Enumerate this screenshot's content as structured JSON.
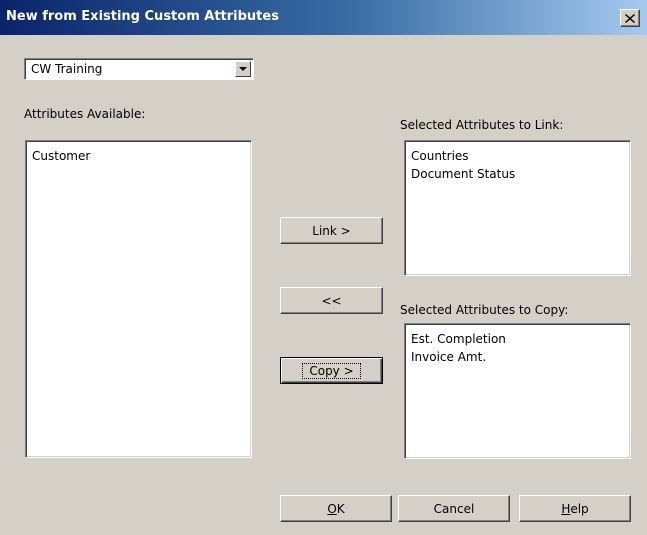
{
  "window": {
    "title": "New from Existing Custom Attributes",
    "close_glyph": "✕"
  },
  "project_select": {
    "value": "CW Training",
    "arrow_icon": "chevron-down-icon"
  },
  "available": {
    "label": "Attributes Available:",
    "items": [
      "Customer"
    ]
  },
  "link_list": {
    "label": "Selected Attributes to Link:",
    "items": [
      "Countries",
      "Document Status"
    ]
  },
  "copy_list": {
    "label": "Selected Attributes to Copy:",
    "items": [
      "Est. Completion",
      "Invoice Amt."
    ]
  },
  "buttons": {
    "link": "Link >",
    "remove": "<<",
    "copy": "Copy >",
    "ok_mnemonic": "O",
    "ok_rest": "K",
    "cancel": "Cancel",
    "help_mnemonic": "H",
    "help_rest": "elp"
  }
}
